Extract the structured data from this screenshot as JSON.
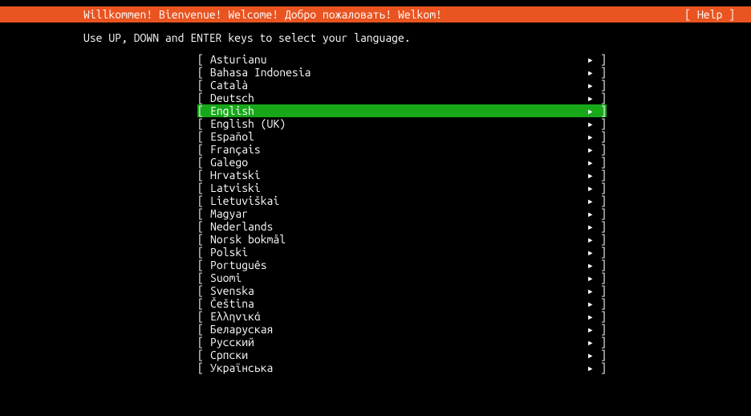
{
  "header": {
    "title": "Willkommen! Bienvenue! Welcome! Добро пожаловать! Welkom!",
    "help": "[ Help ]"
  },
  "instruction": "Use UP, DOWN and ENTER keys to select your language.",
  "arrow_char": "▸",
  "bracket_open": "[ ",
  "bracket_close": " ]",
  "selected_index": 4,
  "languages": [
    {
      "label": "Asturianu"
    },
    {
      "label": "Bahasa Indonesia"
    },
    {
      "label": "Català"
    },
    {
      "label": "Deutsch"
    },
    {
      "label": "English"
    },
    {
      "label": "English (UK)"
    },
    {
      "label": "Español"
    },
    {
      "label": "Français"
    },
    {
      "label": "Galego"
    },
    {
      "label": "Hrvatski"
    },
    {
      "label": "Latviski"
    },
    {
      "label": "Lietuviškai"
    },
    {
      "label": "Magyar"
    },
    {
      "label": "Nederlands"
    },
    {
      "label": "Norsk bokmål"
    },
    {
      "label": "Polski"
    },
    {
      "label": "Português"
    },
    {
      "label": "Suomi"
    },
    {
      "label": "Svenska"
    },
    {
      "label": "Čeština"
    },
    {
      "label": "Ελληνικά"
    },
    {
      "label": "Беларуская"
    },
    {
      "label": "Русский"
    },
    {
      "label": "Српски"
    },
    {
      "label": "Українська"
    }
  ]
}
